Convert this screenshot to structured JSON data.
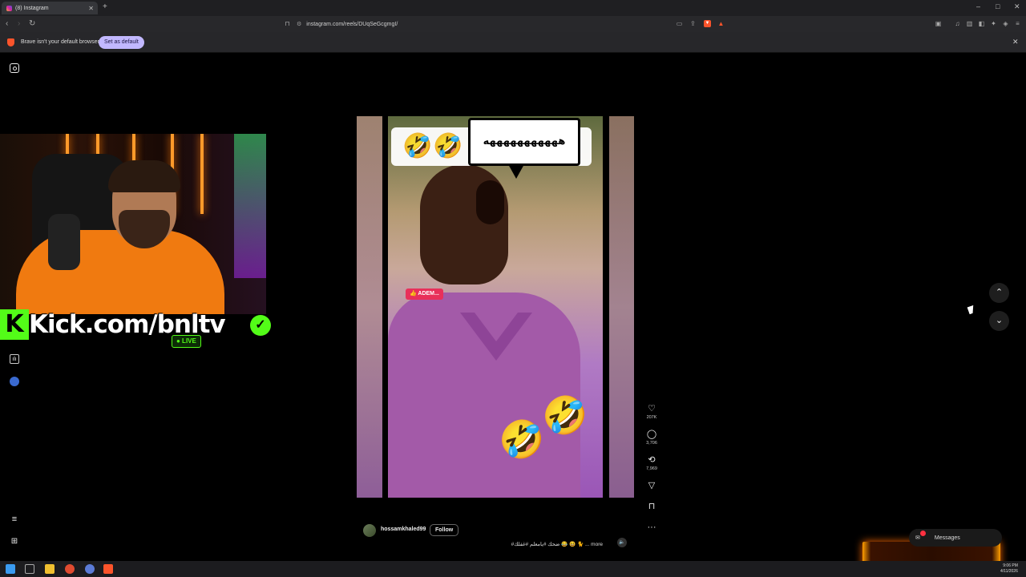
{
  "browser": {
    "tab_title": "(8) Instagram",
    "new_tab": "+",
    "url": "instagram.com/reels/DUqSeGcgmgI/",
    "min": "–",
    "max": "□",
    "close": "✕"
  },
  "infobar": {
    "text": "Brave isn't your default browser",
    "button": "Set as default",
    "close": "✕"
  },
  "stream": {
    "kick_logo": "K",
    "kick_url": "Kick.com/bnltv",
    "live_label": "● LIVE",
    "verified": "✓"
  },
  "reel": {
    "banner_emoji_1": "🤣",
    "banner_emoji_2": "🤣",
    "bubble_text": "هههههههههههه",
    "tag": "👍 ADEM...",
    "emoji_big_1": "🤣",
    "emoji_big_2": "🤣",
    "username": "hossamkhaled99",
    "follow": "Follow",
    "caption": "#ضحك #يامعلم #غفلك 😂 😆 🐈 ... more",
    "mute": "🔈"
  },
  "actions": {
    "likes": "207K",
    "comments": "3,706",
    "reposts": "7,969",
    "like_icon": "♡",
    "comment_icon": "◯",
    "repost_icon": "⟲",
    "share_icon": "▽",
    "save_icon": "⊓",
    "more_icon": "···"
  },
  "nav": {
    "up": "⌃",
    "down": "⌄"
  },
  "messages": {
    "label": "Messages",
    "badge": "8"
  },
  "taskbar": {
    "time": "9:06 PM",
    "date": "4/11/2026"
  },
  "colors": {
    "kick_green": "#53fc18",
    "brave_orange": "#fb542b",
    "set_default_bg": "#c2b8ff"
  }
}
